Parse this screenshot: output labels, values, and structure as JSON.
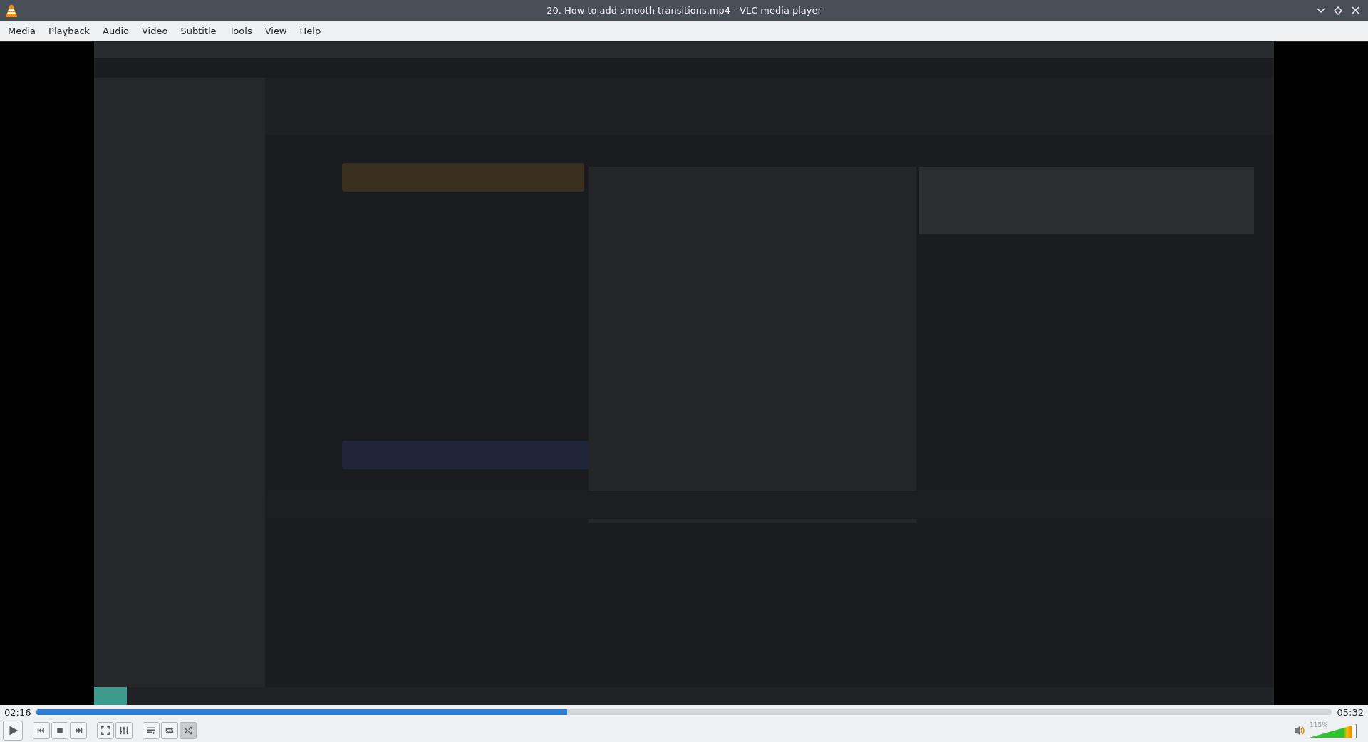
{
  "window": {
    "title": "20. How to add smooth transitions.mp4 - VLC media player"
  },
  "menu": [
    "Media",
    "Playback",
    "Audio",
    "Video",
    "Subtitle",
    "Tools",
    "View",
    "Help"
  ],
  "seek": {
    "elapsed": "02:16",
    "level": 0.41,
    "total": "05:32"
  },
  "controls": [
    {
      "kind": "previous"
    },
    {
      "kind": "stop"
    },
    {
      "kind": "next"
    }
  ],
  "view_controls": [
    {
      "kind": "fullscreen"
    },
    {
      "kind": "extended"
    }
  ],
  "toggles": [
    {
      "kind": "playlist",
      "on": false
    },
    {
      "kind": "loop",
      "on": false
    },
    {
      "kind": "random",
      "on": true
    }
  ],
  "volume": {
    "label": "115%",
    "level": 0.92
  }
}
